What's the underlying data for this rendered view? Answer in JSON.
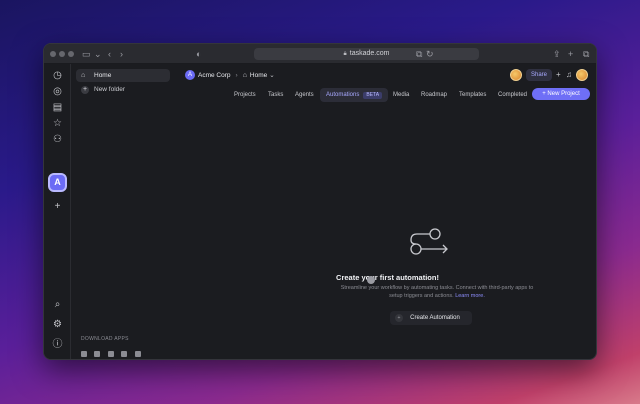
{
  "browser": {
    "url": "taskade.com",
    "lock_icon": "lock-icon"
  },
  "colors": {
    "accent": "#6b6bf5",
    "window_bg": "#1b1c20",
    "link": "#8e8fff"
  },
  "sidenav": {
    "home_label": "Home",
    "new_folder_label": "New folder",
    "download_label": "DOWNLOAD APPS",
    "workspace_initial": "A"
  },
  "header": {
    "workspace_initial": "A",
    "workspace_name": "Acme Corp",
    "breadcrumb_home": "Home",
    "share_label": "Share",
    "new_project_label": "+ New Project"
  },
  "tabs": [
    {
      "label": "Projects"
    },
    {
      "label": "Tasks"
    },
    {
      "label": "Agents"
    },
    {
      "label": "Automations",
      "badge": "BETA"
    },
    {
      "label": "Media"
    },
    {
      "label": "Roadmap"
    },
    {
      "label": "Templates"
    },
    {
      "label": "Completed"
    }
  ],
  "empty_state": {
    "title": "Create your first automation!",
    "description": "Streamline your workflow by automating tasks. Connect with third-party apps to setup triggers and actions.",
    "link_text": "Learn more.",
    "button_label": "Create Automation"
  }
}
